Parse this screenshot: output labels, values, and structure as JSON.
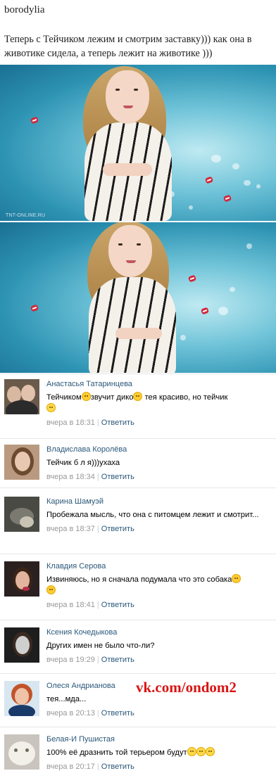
{
  "post": {
    "author": "borodylia",
    "text": "Теперь с Тейчиком лежим и смотрим заставку))) как она в животике сидела, а теперь лежит на животике )))"
  },
  "photos": {
    "channel_watermark": "TNT-ONLINE.RU"
  },
  "comments": [
    {
      "name": "Анастасья Татаринцева",
      "text_parts": [
        "Тейчиком",
        "звучит дико",
        "тея красиво, но тейчик"
      ],
      "emojis": [
        "neutral-face-emoji",
        "flushed-face-emoji",
        "laughing-tears-emoji"
      ],
      "date": "вчера в 18:31",
      "reply": "Ответить",
      "avatar": "couple-photo"
    },
    {
      "name": "Владислава Королёва",
      "text": "Тейчик б л я)))ухаха",
      "date": "вчера в 18:34",
      "reply": "Ответить",
      "avatar": "girl-photo"
    },
    {
      "name": "Карина Шамуэй",
      "text": "Пробежала мысль, что она с питомцем лежит и смотрит...",
      "date": "вчера в 18:37",
      "reply": "Ответить",
      "avatar": "dark-photo"
    },
    {
      "name": "Клавдия Серова",
      "text": "Извиняюсь, но я сначала подумала что это собака",
      "emojis": [
        "disappointed-face-emoji",
        "flushed-face-emoji"
      ],
      "date": "вчера в 18:41",
      "reply": "Ответить",
      "avatar": "girl-dark-photo"
    },
    {
      "name": "Ксения Кочедыкова",
      "text": "Других имен не было что-ли?",
      "date": "вчера в 19:29",
      "reply": "Ответить",
      "avatar": "girl-photo"
    },
    {
      "name": "Олеся Андрианова",
      "text": "тея...мда...",
      "date": "вчера в 20:13",
      "reply": "Ответить",
      "avatar": "woman-red-hair-photo"
    },
    {
      "name": "Белая-И Пушистая",
      "text": "100% её дразнить той терьером будут",
      "emojis": [
        "laughing-tears-emoji",
        "laughing-tears-emoji",
        "laughing-tears-emoji"
      ],
      "date": "вчера в 20:17",
      "reply": "Ответить",
      "avatar": "white-cat-photo"
    }
  ],
  "watermark": "vk.com/ondom2",
  "colors": {
    "link": "#2b587a",
    "meta": "#999999",
    "watermark": "#d81414",
    "photo_bg": "#2d93b3"
  }
}
